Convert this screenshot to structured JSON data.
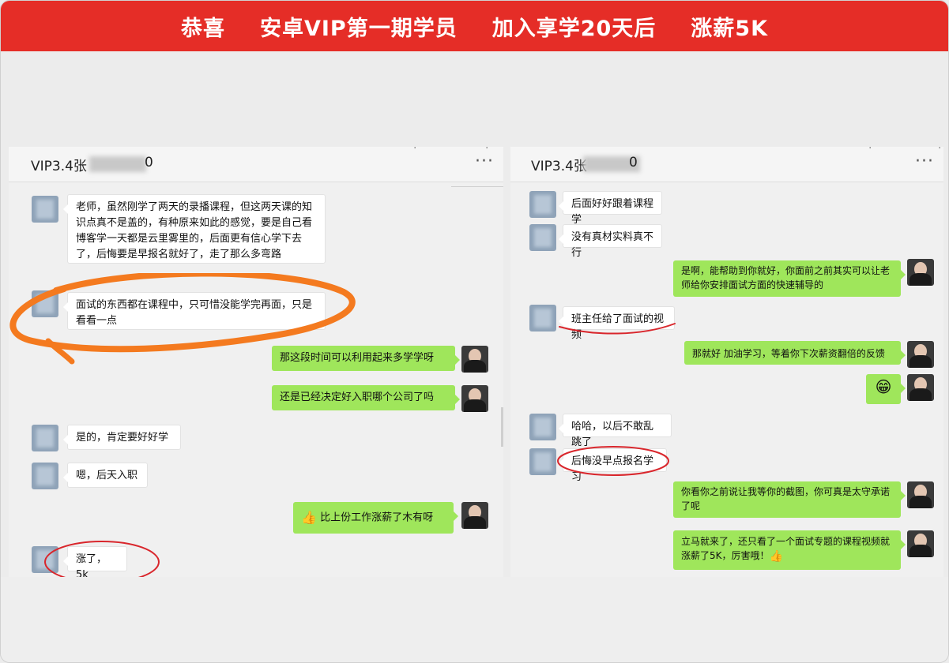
{
  "banner": {
    "t1": "恭喜",
    "t2": "安卓VIP第一期学员",
    "t3": "加入享学20天后",
    "t4": "涨薪5K"
  },
  "left": {
    "title": "VIP3.4张",
    "title_tail": "0",
    "more": "···",
    "messages": [
      {
        "text": "老师，虽然刚学了两天的录播课程，但这两天课的知识点真不是盖的，有种原来如此的感觉，要是自己看博客学一天都是云里雾里的，后面更有信心学下去了，后悔要是早报名就好了，走了那么多弯路"
      },
      {
        "text": "面试的东西都在课程中，只可惜没能学完再面，只是看看一点"
      },
      {
        "text": "那这段时间可以利用起来多学学呀"
      },
      {
        "text": "还是已经决定好入职哪个公司了吗"
      },
      {
        "text": "是的，肯定要好好学"
      },
      {
        "text": "嗯，后天入职"
      },
      {
        "text": "比上份工作涨薪了木有呀"
      },
      {
        "text": "涨了，5k"
      }
    ]
  },
  "right": {
    "title": "VIP3.4张",
    "title_tail": "0",
    "more": "···",
    "messages": [
      {
        "text": "后面好好跟着课程学"
      },
      {
        "text": "没有真材实料真不行"
      },
      {
        "text": "是啊，能帮助到你就好，你面前之前其实可以让老师给你安排面试方面的快速辅导的"
      },
      {
        "text": "班主任给了面试的视频"
      },
      {
        "text": "那就好  加油学习，等着你下次薪资翻倍的反馈"
      },
      {
        "text": "😁"
      },
      {
        "text": "哈哈，以后不敢乱跳了"
      },
      {
        "text": "后悔没早点报名学习"
      },
      {
        "text": "你看你之前说让我等你的截图，你可真是太守承诺了呢"
      },
      {
        "text": "立马就来了，还只看了一个面试专题的课程视频就涨薪了5K，厉害哦！"
      }
    ]
  },
  "icons": {
    "thumb": "👍",
    "grin": "😁"
  },
  "colors": {
    "banner": "#e52d27",
    "green_bubble": "#9fe65b",
    "orange_mark": "#f47a1f",
    "red_mark": "#d9262c"
  }
}
